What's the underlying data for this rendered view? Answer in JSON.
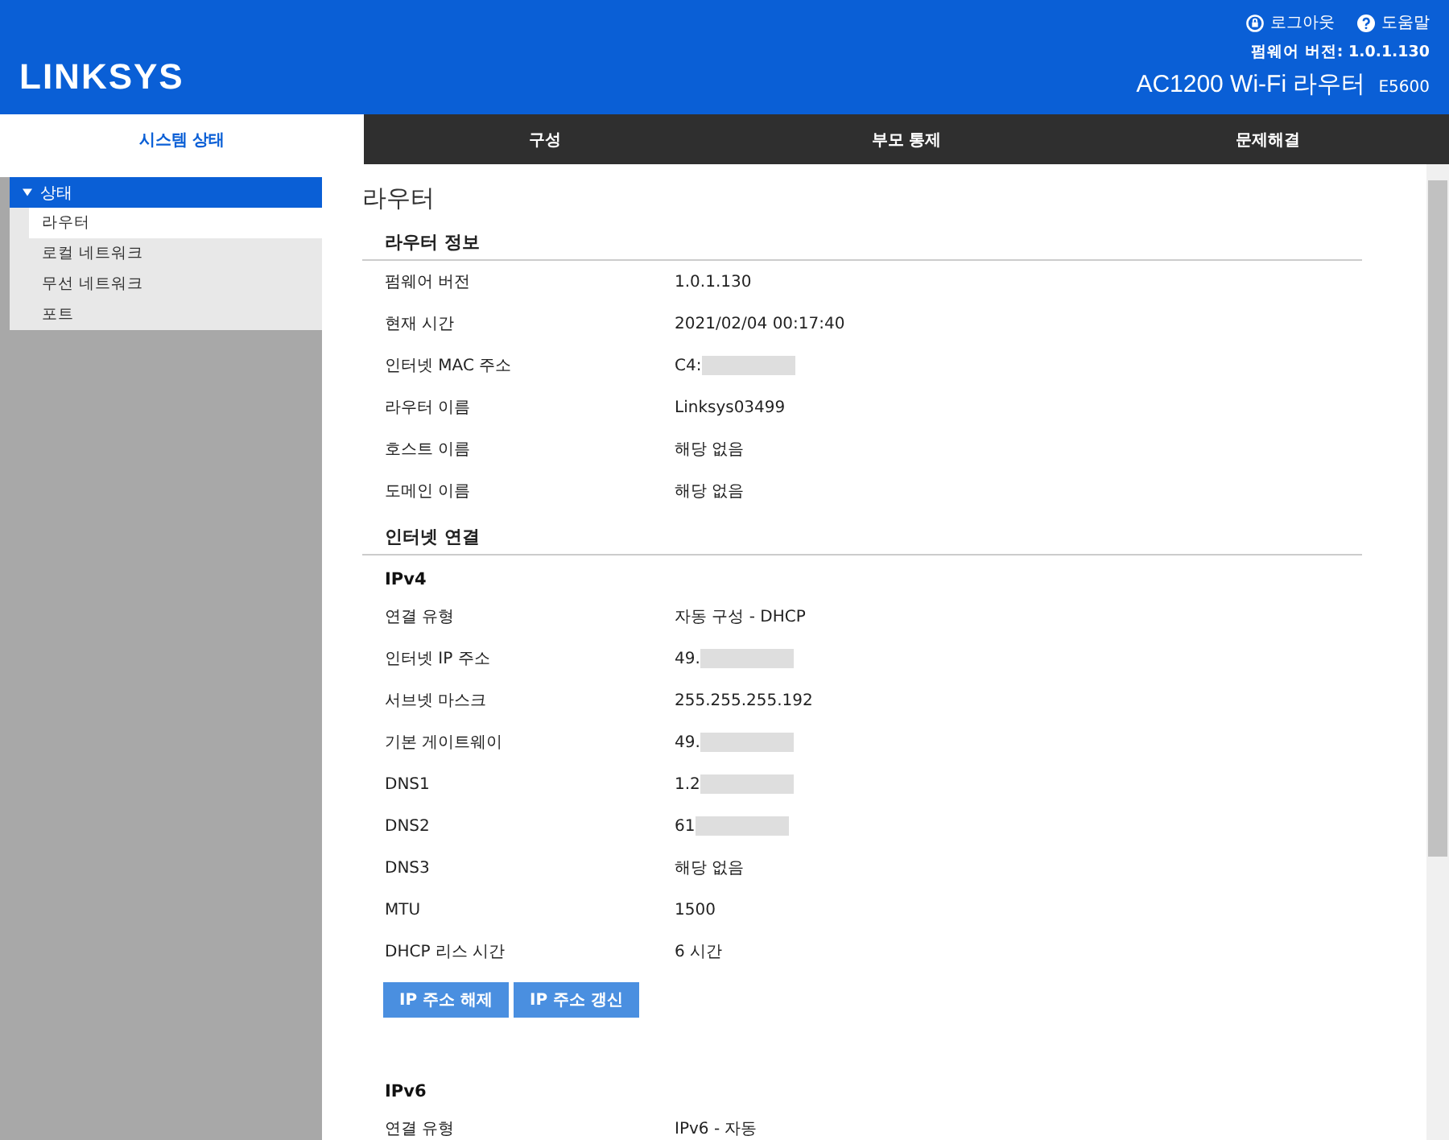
{
  "header": {
    "logo": "LINKSYS",
    "links": [
      {
        "kind": "logout",
        "label": "로그아웃"
      },
      {
        "kind": "help",
        "label": "도움말"
      }
    ],
    "firmware": "펌웨어 버전: 1.0.1.130",
    "product": "AC1200 Wi-Fi 라우터",
    "model": "E5600"
  },
  "nav": [
    {
      "label": "시스템 상태",
      "selected": true
    },
    {
      "label": "구성",
      "selected": false
    },
    {
      "label": "부모 통제",
      "selected": false
    },
    {
      "label": "문제해결",
      "selected": false
    }
  ],
  "sidebar": {
    "items": [
      {
        "label": "상태",
        "expanded": true,
        "children": [
          {
            "label": "라우터",
            "selected": true
          },
          {
            "label": "로컬 네트워크",
            "selected": false
          },
          {
            "label": "무선 네트워크",
            "selected": false
          },
          {
            "label": "포트",
            "selected": false
          }
        ]
      }
    ]
  },
  "page_title": "라우터",
  "sections": [
    {
      "kind": "section",
      "title": "라우터 정보",
      "rows": [
        {
          "label": "펌웨어 버전",
          "value": "1.0.1.130"
        },
        {
          "label": "현재 시간",
          "value": "2021/02/04 00:17:40"
        },
        {
          "label": "인터넷 MAC 주소",
          "value": "C4:",
          "blurred": true
        },
        {
          "label": "라우터 이름",
          "value": "Linksys03499"
        },
        {
          "label": "호스트 이름",
          "value": "해당 없음"
        },
        {
          "label": "도메인 이름",
          "value": "해당 없음"
        }
      ]
    },
    {
      "kind": "section",
      "title": "인터넷 연결"
    },
    {
      "kind": "subsection",
      "title": "IPv4",
      "rows": [
        {
          "label": "연결 유형",
          "value": "자동 구성 - DHCP"
        },
        {
          "label": "인터넷 IP 주소",
          "value": "49.",
          "blurred": true
        },
        {
          "label": "서브넷 마스크",
          "value": "255.255.255.192"
        },
        {
          "label": "기본 게이트웨이",
          "value": "49.",
          "blurred": true
        },
        {
          "label": "DNS1",
          "value": "1.2",
          "blurred": true
        },
        {
          "label": "DNS2",
          "value": "61",
          "blurred": true
        },
        {
          "label": "DNS3",
          "value": "해당 없음"
        },
        {
          "label": "MTU",
          "value": "1500"
        },
        {
          "label": "DHCP 리스 시간",
          "value": "6 시간"
        }
      ],
      "buttons": [
        "IP 주소 해제",
        "IP 주소 갱신"
      ]
    },
    {
      "kind": "subsection",
      "title": "IPv6",
      "rows": [
        {
          "label": "연결 유형",
          "value": "IPv6 - 자동"
        }
      ]
    }
  ]
}
